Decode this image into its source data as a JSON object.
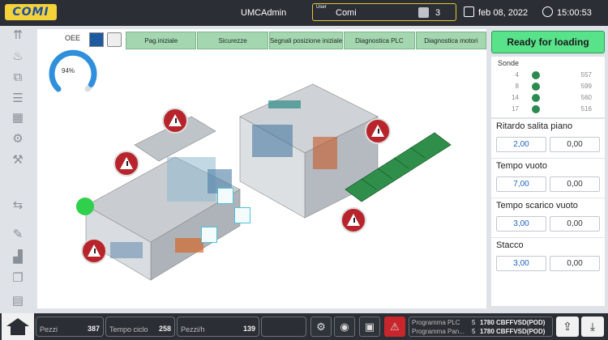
{
  "header": {
    "logo": "COMI",
    "user_display": "UMCAdmin",
    "user_label": "User",
    "user_value": "Comi",
    "user_level": "3",
    "date": "feb 08, 2022",
    "time": "15:00:53"
  },
  "sidebar": {
    "icons": [
      "upload-arrows-icon",
      "flame-icon",
      "resize-icon",
      "align-lines-icon",
      "boxes-icon",
      "conveyor-icon",
      "robot-arm-icon",
      "swap-arrows-icon",
      "wrench-icon",
      "stats-chart-icon",
      "documents-icon",
      "scroll-icon"
    ]
  },
  "main": {
    "oee_label": "OEE",
    "oee_value": "94%",
    "oee_fraction": 0.94,
    "tabs": [
      "Pag.iniziale",
      "Sicurezze",
      "Segnali posizione iniziale",
      "Diagnostica PLC",
      "Diagnostica motori"
    ]
  },
  "right": {
    "status": "Ready for loading",
    "sonde_title": "Sonde",
    "sonde": [
      {
        "id": "4",
        "value": "557"
      },
      {
        "id": "8",
        "value": "599"
      },
      {
        "id": "14",
        "value": "560"
      },
      {
        "id": "17",
        "value": "516"
      }
    ],
    "params": [
      {
        "title": "Ritardo salita piano",
        "set": "2,00",
        "actual": "0,00"
      },
      {
        "title": "Tempo vuoto",
        "set": "7,00",
        "actual": "0,00"
      },
      {
        "title": "Tempo scarico vuoto",
        "set": "3,00",
        "actual": "0,00"
      },
      {
        "title": "Stacco",
        "set": "3,00",
        "actual": "0,00"
      }
    ]
  },
  "bottom": {
    "pezzi_label": "Pezzi",
    "pezzi_value": "387",
    "tempo_label": "Tempo ciclo",
    "tempo_value": "258",
    "pezzih_label": "Pezzi/h",
    "pezzih_value": "139",
    "prog_plc_label": "Programma PLC",
    "prog_plc_num": "5",
    "prog_plc_code": "1780 CBFFVSD(POD)",
    "prog_pan_label": "Programma Pan...",
    "prog_pan_num": "5",
    "prog_pan_code": "1780 CBFFVSD(POD)"
  }
}
